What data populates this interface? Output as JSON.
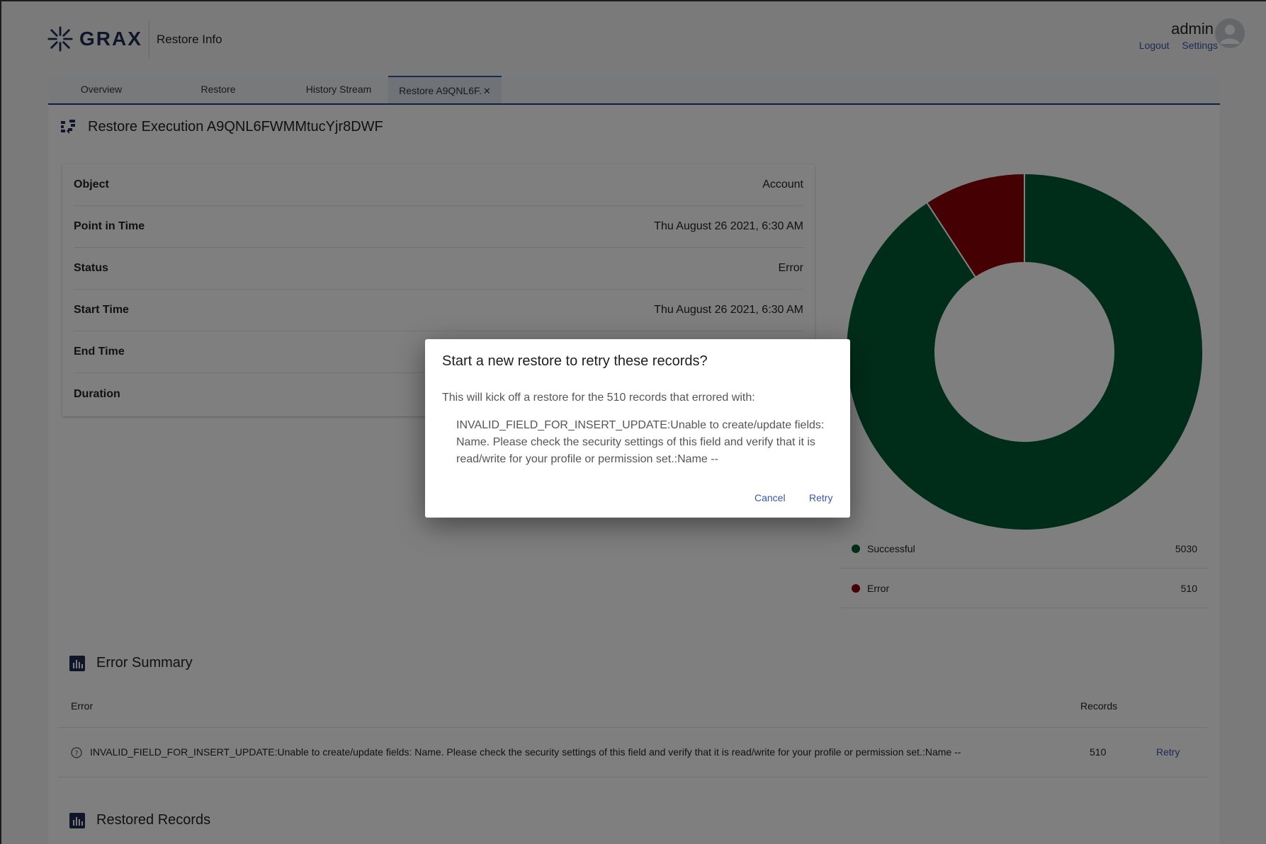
{
  "header": {
    "logo_text": "GRAX",
    "title": "Restore Info",
    "user_name": "admin",
    "logout_label": "Logout",
    "settings_label": "Settings"
  },
  "tabs": [
    {
      "label": "Overview"
    },
    {
      "label": "Restore"
    },
    {
      "label": "History Stream"
    },
    {
      "label": "Restore A9QNL6F."
    }
  ],
  "execution": {
    "title": "Restore Execution A9QNL6FWMMtucYjr8DWF",
    "rows": [
      {
        "label": "Object",
        "value": "Account"
      },
      {
        "label": "Point in Time",
        "value": "Thu August 26 2021, 6:30 AM"
      },
      {
        "label": "Status",
        "value": "Error"
      },
      {
        "label": "Start Time",
        "value": "Thu August 26 2021, 6:30 AM"
      },
      {
        "label": "End Time",
        "value": ""
      },
      {
        "label": "Duration",
        "value": ""
      }
    ]
  },
  "chart_data": {
    "type": "pie",
    "categories": [
      "Successful",
      "Error"
    ],
    "values": [
      5030,
      510
    ],
    "colors": [
      "#005a33",
      "#8b0008"
    ]
  },
  "legend": [
    {
      "label": "Successful",
      "count": "5030",
      "color": "#005a33"
    },
    {
      "label": "Error",
      "count": "510",
      "color": "#8b0008"
    }
  ],
  "error_summary": {
    "title": "Error Summary",
    "col_error": "Error",
    "col_records": "Records",
    "rows": [
      {
        "message": "INVALID_FIELD_FOR_INSERT_UPDATE:Unable to create/update fields: Name. Please check the security settings of this field and verify that it is read/write for your profile or permission set.:Name --",
        "records": "510",
        "action": "Retry"
      }
    ]
  },
  "restored_records": {
    "title": "Restored Records"
  },
  "dialog": {
    "title": "Start a new restore to retry these records?",
    "body": "This will kick off a restore for the 510 records that errored with:",
    "error_text": "INVALID_FIELD_FOR_INSERT_UPDATE:Unable to create/update fields: Name. Please check the security settings of this field and verify that it is read/write for your profile or permission set.:Name --",
    "cancel_label": "Cancel",
    "retry_label": "Retry"
  }
}
